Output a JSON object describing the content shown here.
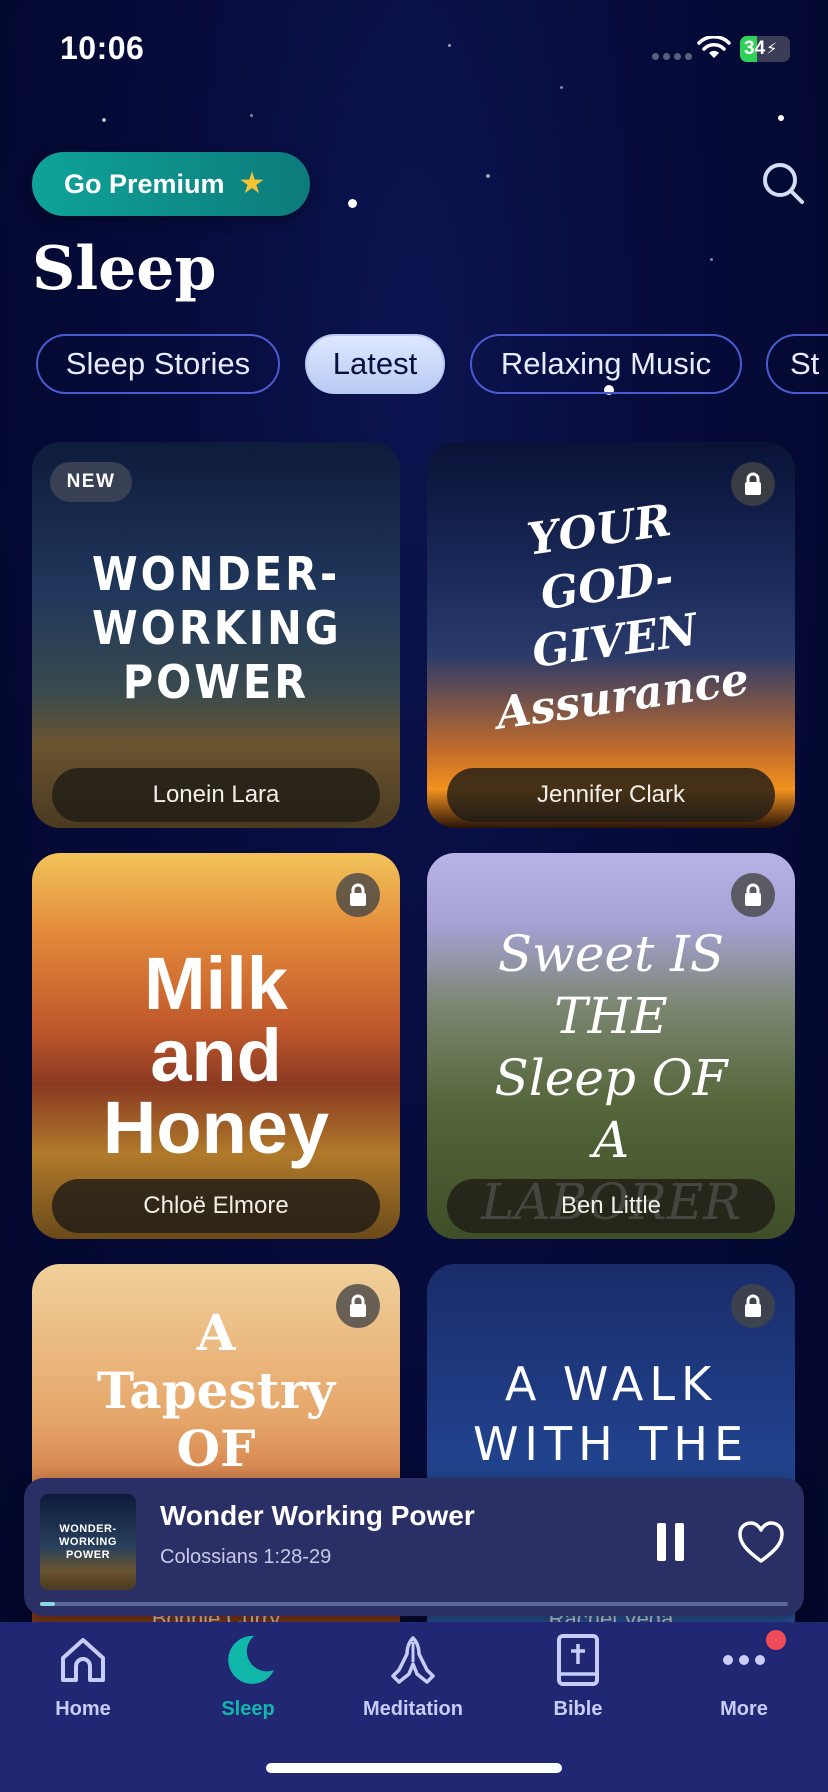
{
  "status_bar": {
    "time": "10:06",
    "battery_level": "34",
    "battery_fraction": 0.34,
    "wifi_icon": "wifi-icon"
  },
  "header": {
    "premium_label": "Go Premium",
    "premium_icon": "star-icon",
    "search_icon": "search-icon",
    "page_title": "Sleep"
  },
  "tabs": [
    {
      "label": "Sleep Stories",
      "active": false
    },
    {
      "label": "Latest",
      "active": true
    },
    {
      "label": "Relaxing Music",
      "active": false
    },
    {
      "label": "St",
      "active": false
    }
  ],
  "cards": [
    {
      "title": "WONDER-WORKING POWER",
      "author": "Lonein Lara",
      "badge": "NEW",
      "locked": false
    },
    {
      "title": "YOUR GOD-GIVEN Assurance",
      "author": "Jennifer Clark",
      "locked": true
    },
    {
      "title": "Milk and Honey",
      "author": "Chloë Elmore",
      "locked": true
    },
    {
      "title": "Sweet IS THE Sleep OF A LABORER",
      "author": "Ben Little",
      "locked": true
    },
    {
      "title": "A Tapestry OF",
      "author": "Bonnie Curry",
      "locked": true
    },
    {
      "title": "A WALK WITH THE GOOD SHEPHERD",
      "author": "Rachel Vega",
      "locked": true
    }
  ],
  "now_playing": {
    "title": "Wonder Working Power",
    "subtitle": "Colossians 1:28-29",
    "thumb_title": "WONDER-WORKING POWER",
    "progress": 0.02,
    "pause_icon": "pause-icon",
    "heart_icon": "heart-icon"
  },
  "nav": [
    {
      "label": "Home",
      "icon": "home-icon",
      "active": false
    },
    {
      "label": "Sleep",
      "icon": "moon-icon",
      "active": true
    },
    {
      "label": "Meditation",
      "icon": "praying-hands-icon",
      "active": false
    },
    {
      "label": "Bible",
      "icon": "bible-icon",
      "active": false
    },
    {
      "label": "More",
      "icon": "more-icon",
      "active": false
    }
  ],
  "colors": {
    "background": "#050a33",
    "accent_teal": "#11b8aa",
    "tab_bar": "#222774",
    "notification_dot": "#f04c58"
  }
}
